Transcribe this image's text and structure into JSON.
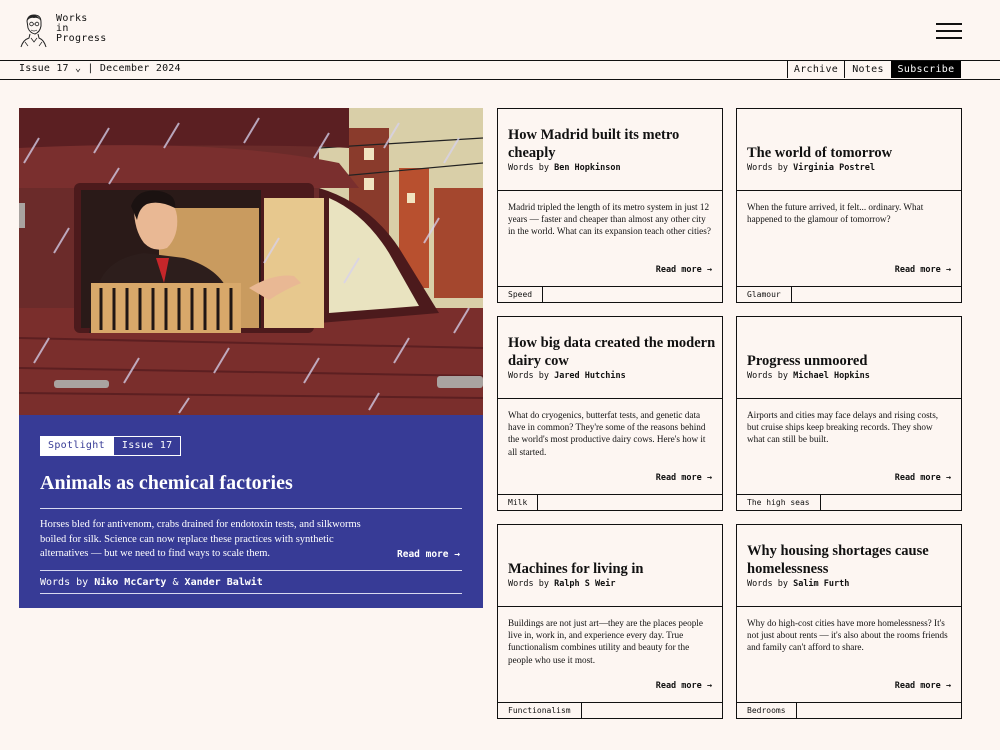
{
  "site": {
    "name_line1": "Works",
    "name_line2": "in",
    "name_line3": "Progress"
  },
  "subbar": {
    "issue_label": "Issue 17 ⌄ | December 2024",
    "archive_label": "Archive",
    "notes_label": "Notes",
    "subscribe_label": "Subscribe"
  },
  "hero": {
    "tag_primary": "Spotlight",
    "tag_issue": "Issue 17",
    "title": "Animals as chemical factories",
    "summary": "Horses bled for antivenom, crabs drained for endotoxin tests, and silkworms boiled for silk. Science can now replace these practices with synthetic alternatives — but we need to find ways to scale them.",
    "read_more": "Read more →",
    "byline_prefix": "Words by",
    "author1": "Niko McCarty",
    "amp": "&",
    "author2": "Xander Balwit"
  },
  "cards": [
    {
      "title": "How Madrid built its metro cheaply",
      "byline_prefix": "Words by",
      "author": "Ben Hopkinson",
      "summary": "Madrid tripled the length of its metro system in just 12 years — faster and cheaper than almost any other city in the world. What can its expansion teach other cities?",
      "read_more": "Read more →",
      "tag": "Speed"
    },
    {
      "title": "The world of tomorrow",
      "byline_prefix": "Words by",
      "author": "Virginia Postrel",
      "summary": "When the future arrived, it felt... ordinary. What happened to the glamour of tomorrow?",
      "read_more": "Read more →",
      "tag": "Glamour"
    },
    {
      "title": "How big data created the modern dairy cow",
      "byline_prefix": "Words by",
      "author": "Jared Hutchins",
      "summary": "What do cryogenics, butterfat tests, and genetic data have in common? They're some of the reasons behind the world's most productive dairy cows. Here's how it all started.",
      "read_more": "Read more →",
      "tag": "Milk"
    },
    {
      "title": "Progress unmoored",
      "byline_prefix": "Words by",
      "author": "Michael Hopkins",
      "summary": "Airports and cities may face delays and rising costs, but cruise ships keep breaking records. They show what can still be built.",
      "read_more": "Read more →",
      "tag": "The high seas"
    },
    {
      "title": "Machines for living in",
      "byline_prefix": "Words by",
      "author": "Ralph S Weir",
      "summary": "Buildings are not just art—they are the places people live in, work in, and experience every day. True functionalism combines utility and beauty for the people who use it most.",
      "read_more": "Read more →",
      "tag": "Functionalism"
    },
    {
      "title": "Why housing shortages cause homelessness",
      "byline_prefix": "Words by",
      "author": "Salim Furth",
      "summary": "Why do high-cost cities have more homelessness? It's not just about rents — it's also about the rooms friends and family can't afford to share.",
      "read_more": "Read more →",
      "tag": "Bedrooms"
    }
  ],
  "colors": {
    "background": "#fdf6f2",
    "hero_panel": "#373b96",
    "ink": "#111111"
  },
  "icons": {
    "menu": "hamburger-menu-icon",
    "logo": "portrait-sketch-logo"
  }
}
